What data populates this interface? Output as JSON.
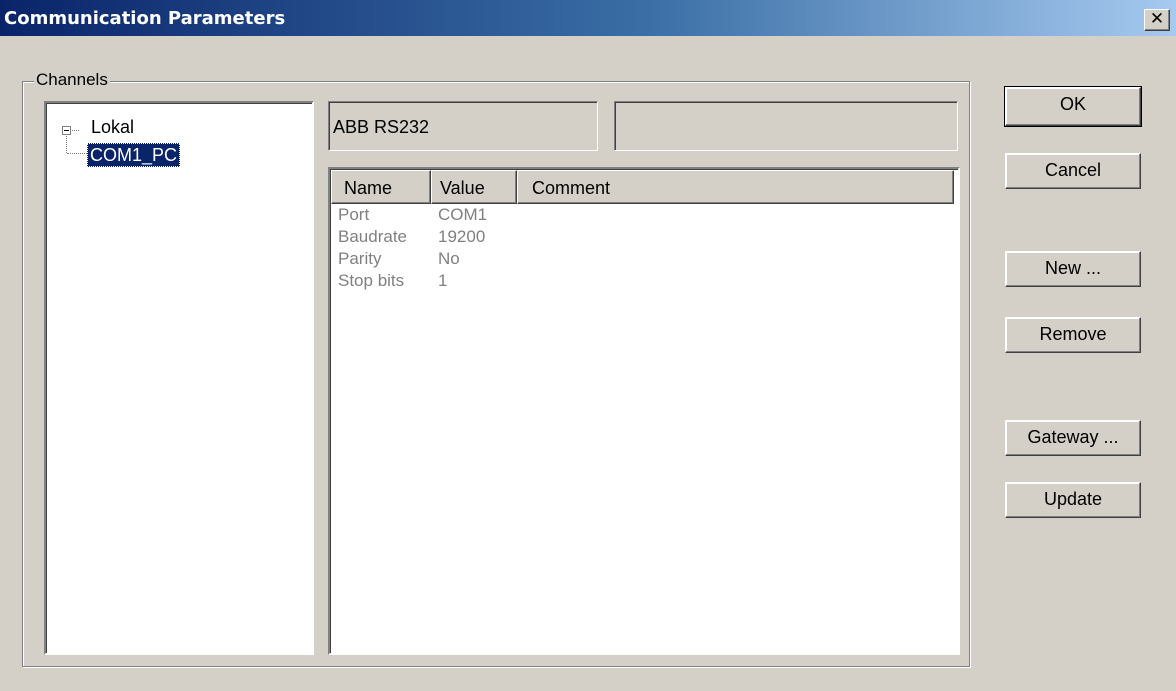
{
  "window": {
    "title": "Communication Parameters",
    "close_glyph": "✕"
  },
  "channels": {
    "label": "Channels",
    "tree": {
      "root": "Lokal",
      "child": "COM1_PC"
    }
  },
  "channel_info": {
    "name": "ABB RS232",
    "extra": ""
  },
  "parameters": {
    "columns": [
      "Name",
      "Value",
      "Comment"
    ],
    "rows": [
      {
        "name": "Port",
        "value": "COM1",
        "comment": ""
      },
      {
        "name": "Baudrate",
        "value": "19200",
        "comment": ""
      },
      {
        "name": "Parity",
        "value": "No",
        "comment": ""
      },
      {
        "name": "Stop bits",
        "value": "1",
        "comment": ""
      }
    ]
  },
  "buttons": {
    "ok": "OK",
    "cancel": "Cancel",
    "new": "New ...",
    "remove": "Remove",
    "gateway": "Gateway ...",
    "update": "Update"
  },
  "colors": {
    "title_gradient_start": "#0a246a",
    "title_gradient_end": "#a6caf0",
    "selection": "#0a246a",
    "dialog_face": "#d4d0c8",
    "disabled_text": "#808080"
  }
}
